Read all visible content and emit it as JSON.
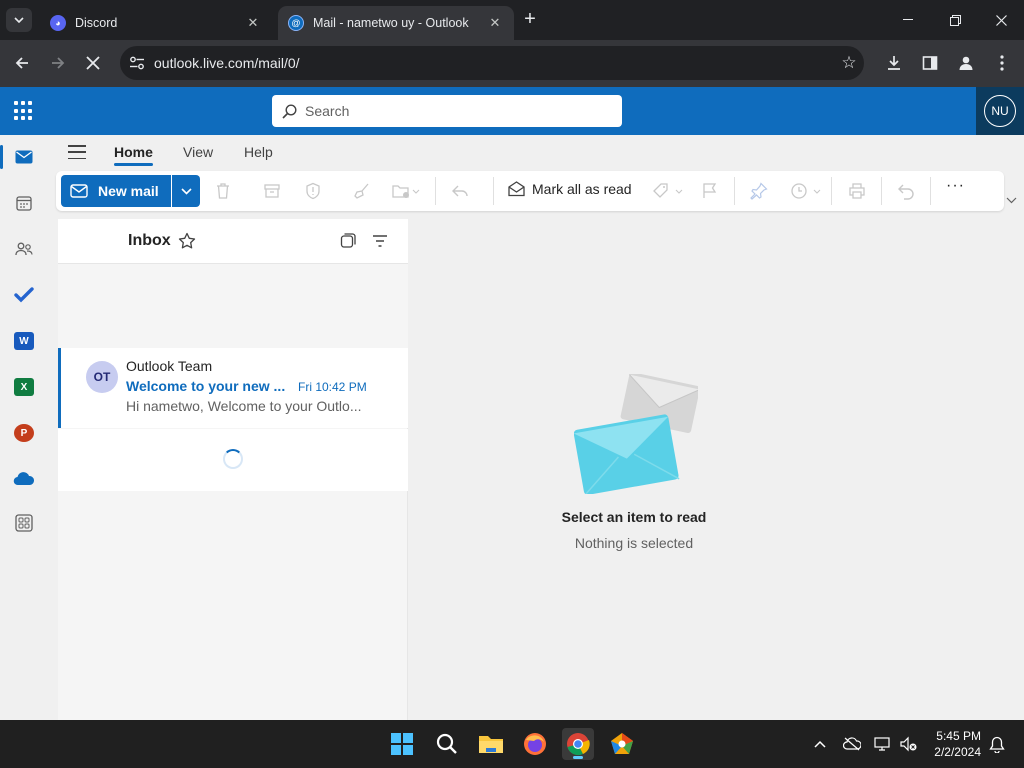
{
  "browser": {
    "tabs": [
      {
        "title": "Discord",
        "active": false
      },
      {
        "title": "Mail - nametwo uy - Outlook",
        "active": true
      }
    ],
    "url": "outlook.live.com/mail/0/"
  },
  "outlook": {
    "search_placeholder": "Search",
    "avatar_initials": "NU",
    "ribbon_tabs": [
      "Home",
      "View",
      "Help"
    ],
    "new_mail_label": "New mail",
    "mark_all_read_label": "Mark all as read",
    "more_label": "···",
    "folder_title": "Inbox",
    "messages": [
      {
        "initials": "OT",
        "sender": "Outlook Team",
        "subject": "Welcome to your new ...",
        "time": "Fri 10:42 PM",
        "preview": "Hi nametwo, Welcome to your Outlo..."
      }
    ],
    "empty_title": "Select an item to read",
    "empty_subtitle": "Nothing is selected"
  },
  "taskbar": {
    "time": "5:45 PM",
    "date": "2/2/2024"
  },
  "colors": {
    "brand": "#0f6cbd",
    "browser_dark": "#202124"
  }
}
